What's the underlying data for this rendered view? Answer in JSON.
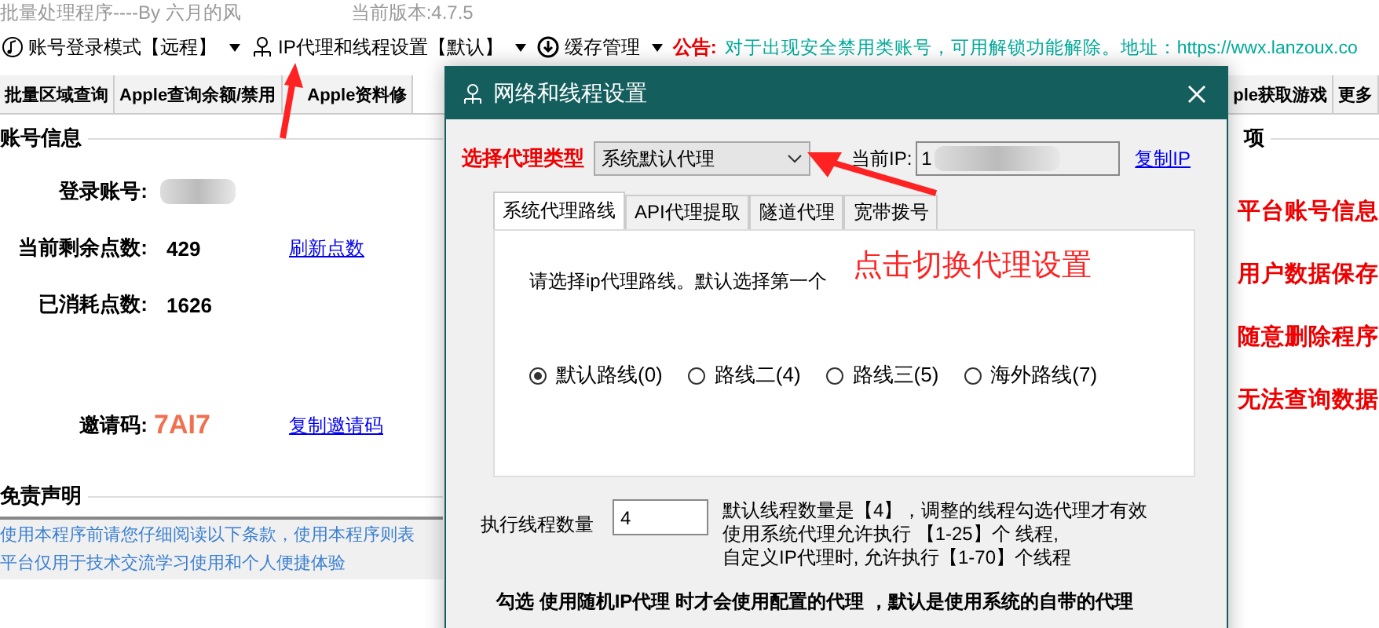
{
  "app": {
    "title": "批量处理程序----By 六月的风",
    "version": "当前版本:4.7.5"
  },
  "toolbar": [
    {
      "kind": "menu",
      "label": "账号登录模式【远程】"
    },
    {
      "kind": "menu",
      "label": "IP代理和线程设置【默认】"
    },
    {
      "kind": "menu",
      "label": "缓存管理"
    }
  ],
  "notice": {
    "label": "公告:",
    "text": "对于出现安全禁用类账号，可用解锁功能解除。地址：https://wwx.lanzoux.co"
  },
  "main_tabs_left": [
    {
      "label": "批量区域查询",
      "selected": false
    },
    {
      "label": "Apple查询余额/禁用",
      "selected": false
    },
    {
      "label": "Apple资料修",
      "selected": false
    }
  ],
  "main_tabs_right": [
    {
      "label": "ple获取游戏",
      "selected": false
    },
    {
      "label": "更多",
      "selected": false
    }
  ],
  "account": {
    "title": "账号信息",
    "rows": [
      {
        "label": "登录账号:",
        "kind": "blurred"
      },
      {
        "label": "当前剩余点数:",
        "value": "429",
        "link": "刷新点数",
        "kind": "plain"
      },
      {
        "label": "已消耗点数:",
        "value": "1626",
        "kind": "plain"
      },
      {
        "label": "邀请码:",
        "value": "7AI7",
        "link": "复制邀请码",
        "kind": "code"
      }
    ]
  },
  "right_panel": {
    "title": "项",
    "lines": [
      "平台账号信息",
      "用户数据保存",
      "随意删除程序",
      "无法查询数据"
    ]
  },
  "disclaimer": {
    "title": "免责声明",
    "lines": [
      "使用本程序前请您仔细阅读以下条款，使用本程序则表",
      "平台仅用于技术交流学习使用和个人便捷体验"
    ]
  },
  "dialog": {
    "title": "网络和线程设置",
    "proxy_label": "选择代理类型",
    "proxy_value": "系统默认代理",
    "ip_label": "当前IP:",
    "ip_value": "1",
    "copy_ip": "复制IP",
    "tabs": [
      {
        "label": "系统代理路线",
        "selected": true
      },
      {
        "label": "API代理提取",
        "selected": false
      },
      {
        "label": "隧道代理",
        "selected": false
      },
      {
        "label": "宽带拨号",
        "selected": false
      }
    ],
    "hint": "请选择ip代理路线。默认选择第一个",
    "routes": [
      {
        "label": "默认路线(0)",
        "selected": true
      },
      {
        "label": "路线二(4)",
        "selected": false
      },
      {
        "label": "路线三(5)",
        "selected": false
      },
      {
        "label": "海外路线(7)",
        "selected": false
      }
    ],
    "thread_label": "执行线程数量",
    "thread_value": "4",
    "thread_notes": [
      "默认线程数量是【4】，调整的线程勾选代理才有效",
      "使用系统代理允许执行 【1-25】个 线程,",
      "自定义IP代理时, 允许执行【1-70】个线程"
    ],
    "footer": "勾选 使用随机IP代理 时才会使用配置的代理 ，默认是使用系统的自带的代理"
  },
  "annotation": "点击切换代理设置"
}
